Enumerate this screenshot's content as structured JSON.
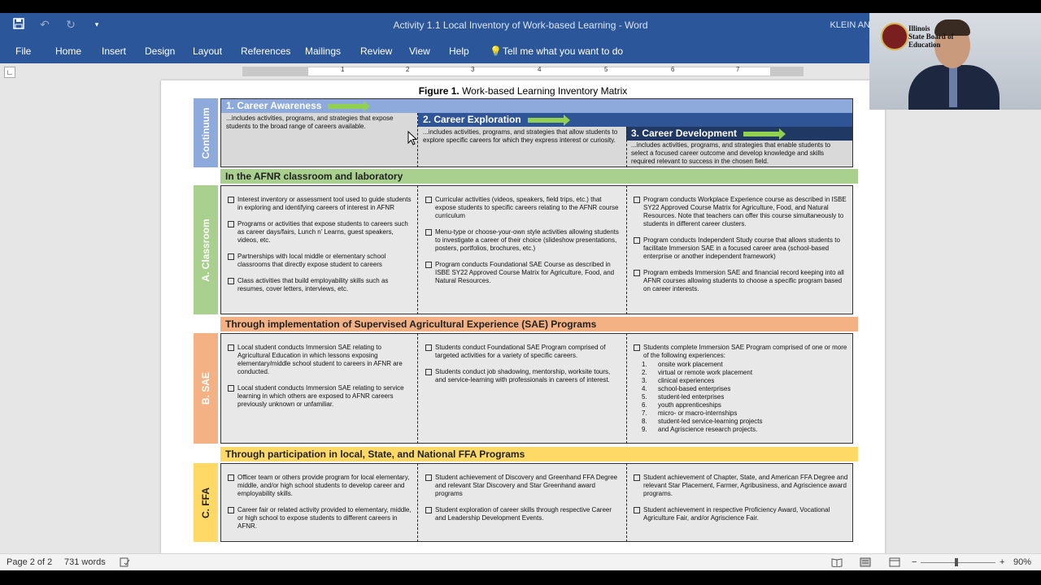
{
  "window": {
    "title": "Activity 1.1 Local Inventory of Work-based Learning  -  Word",
    "user": "KLEIN AN",
    "qat": {
      "save_icon": "save-icon",
      "undo_icon": "undo-icon",
      "redo_icon": "redo-icon",
      "customize_icon": "customize-icon"
    }
  },
  "ribbon": {
    "tabs": [
      "File",
      "Home",
      "Insert",
      "Design",
      "Layout",
      "References",
      "Mailings",
      "Review",
      "View",
      "Help"
    ],
    "tell_me": "Tell me what you want to do"
  },
  "ruler": {
    "numbers": [
      "1",
      "2",
      "3",
      "4",
      "5",
      "6",
      "7"
    ]
  },
  "webcam": {
    "seal_text_1": "Illinois",
    "seal_text_2": "State Board of",
    "seal_text_3": "Education"
  },
  "figure": {
    "title_bold": "Figure 1.",
    "title_rest": " Work-based Learning Inventory Matrix",
    "continuum_label": "Continuum",
    "phases": [
      {
        "title": "1. Career Awareness",
        "desc": "...includes activities, programs, and strategies that expose students to the broad range of careers available."
      },
      {
        "title": "2. Career Exploration",
        "desc": "...includes activities, programs, and strategies that allow students to explore specific careers for which they express interest or curiosity."
      },
      {
        "title": "3. Career Development",
        "desc": "...includes activities, programs, and strategies that enable students to select a focused career outcome and develop knowledge and skills required relevant to success in the chosen field."
      }
    ],
    "sections": [
      {
        "side_label": "A. Classroom",
        "heading": "In the AFNR classroom and laboratory",
        "cols": [
          [
            "Interest inventory or assessment tool used to guide students in exploring and identifying careers of interest in AFNR",
            "Programs or activities that expose students to careers such as career days/fairs, Lunch n' Learns, guest speakers, videos, etc.",
            "Partnerships with local middle or elementary school classrooms that directly expose student to careers",
            "Class activities that build employability skills such as resumes, cover letters, interviews, etc."
          ],
          [
            "Curricular activities (videos, speakers, field trips, etc.) that expose students to specific careers relating to the AFNR course curriculum",
            "Menu-type or choose-your-own style activities allowing students to investigate a career of their choice (slideshow presentations, posters, portfolios, brochures, etc.)",
            "Program conducts Foundational SAE Course as described in ISBE SY22 Approved Course Matrix for Agriculture, Food, and Natural Resources."
          ],
          [
            "Program conducts Workplace Experience course as described in ISBE SY22 Approved Course Matrix for Agriculture, Food, and Natural Resources. Note that teachers can offer this course simultaneously to students in different career clusters.",
            "Program conducts Independent Study course that allows students to facilitate Immersion SAE in a focused career area (school-based enterprise or another independent framework)",
            "Program embeds Immersion SAE and financial record keeping into all AFNR courses allowing students to choose a specific program based on career interests."
          ]
        ]
      },
      {
        "side_label": "B. SAE",
        "heading": "Through implementation of Supervised Agricultural Experience (SAE) Programs",
        "cols": [
          [
            "Local student conducts Immersion SAE relating to Agricultural Education in which lessons exposing elementary/middle school student to careers in AFNR are conducted.",
            "Local student conducts Immersion SAE relating to service learning in which others are exposed to AFNR careers previously unknown or unfamiliar."
          ],
          [
            "Students conduct Foundational SAE Program comprised of targeted activities for a variety of specific careers.",
            "Students conduct job shadowing, mentorship, worksite tours, and service-learning with professionals in careers of interest."
          ],
          [
            "Students complete Immersion SAE Program comprised of one or more of the following experiences:"
          ]
        ],
        "numbered": [
          "onsite work placement",
          "virtual or remote work placement",
          "clinical experiences",
          "school-based enterprises",
          "student-led enterprises",
          "youth apprenticeships",
          "micro- or macro-internships",
          "student-led service-learning projects",
          "and Agriscience research projects."
        ]
      },
      {
        "side_label": "C. FFA",
        "heading": "Through participation in local, State, and National FFA Programs",
        "cols": [
          [
            "Officer team or others provide program for local elementary, middle, and/or high school students to develop career and employability skills.",
            "Career fair or related activity provided to elementary, middle, or high school to expose students to different careers in AFNR."
          ],
          [
            "Student achievement of Discovery and Greenhand FFA Degree and relevant Star Discovery and Star Greenhand award programs",
            "Student exploration of career skills through respective Career and Leadership Development Events."
          ],
          [
            "Student achievement of Chapter, State, and American FFA Degree and relevant Star Placement, Farmer, Agribusiness, and Agriscience award programs.",
            "Student achievement in respective Proficiency Award, Vocational Agriculture Fair, and/or Agriscience Fair."
          ]
        ]
      }
    ]
  },
  "status": {
    "page": "Page 2 of 2",
    "words": "731 words",
    "zoom": "90%"
  },
  "colors": {
    "word_blue": "#2b579a",
    "continuum": "#8ea9db",
    "classroom": "#a9d08e",
    "sae": "#f4b183",
    "ffa": "#ffd966",
    "arrow": "#92d050"
  }
}
